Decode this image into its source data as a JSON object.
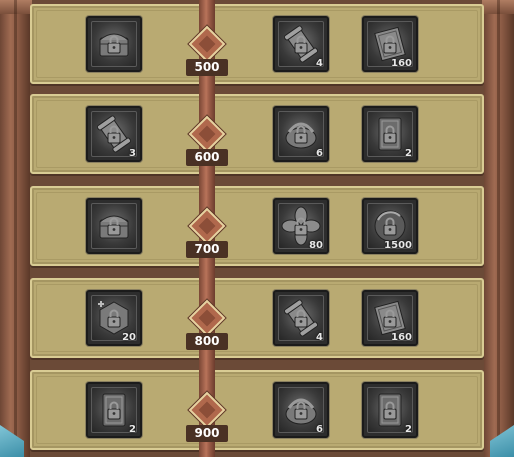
{
  "rows": [
    {
      "milestone": "500",
      "left": [
        {
          "icon": "chest-icon",
          "qty": ""
        }
      ],
      "right": [
        {
          "icon": "scroll-icon",
          "qty": "4"
        },
        {
          "icon": "page-icon",
          "qty": "160"
        }
      ]
    },
    {
      "milestone": "600",
      "left": [
        {
          "icon": "scroll-icon",
          "qty": "3"
        }
      ],
      "right": [
        {
          "icon": "basket-icon",
          "qty": "6"
        },
        {
          "icon": "card-icon",
          "qty": "2"
        }
      ]
    },
    {
      "milestone": "700",
      "left": [
        {
          "icon": "chest-icon",
          "qty": ""
        }
      ],
      "right": [
        {
          "icon": "flower-icon",
          "qty": "80"
        },
        {
          "icon": "orb-icon",
          "qty": "1500"
        }
      ]
    },
    {
      "milestone": "800",
      "left": [
        {
          "icon": "hexagon-icon",
          "qty": "20"
        }
      ],
      "right": [
        {
          "icon": "scroll-icon",
          "qty": "4"
        },
        {
          "icon": "page-icon",
          "qty": "160"
        }
      ]
    },
    {
      "milestone": "900",
      "left": [
        {
          "icon": "card-icon",
          "qty": "2"
        }
      ],
      "right": [
        {
          "icon": "basket-icon",
          "qty": "6"
        },
        {
          "icon": "card-icon",
          "qty": "2"
        }
      ]
    }
  ],
  "colors": {
    "panel": "#b9aa72",
    "track": "#a0604a",
    "label_bg": "#4a3124",
    "slot_bg": "#2d2d2d"
  }
}
